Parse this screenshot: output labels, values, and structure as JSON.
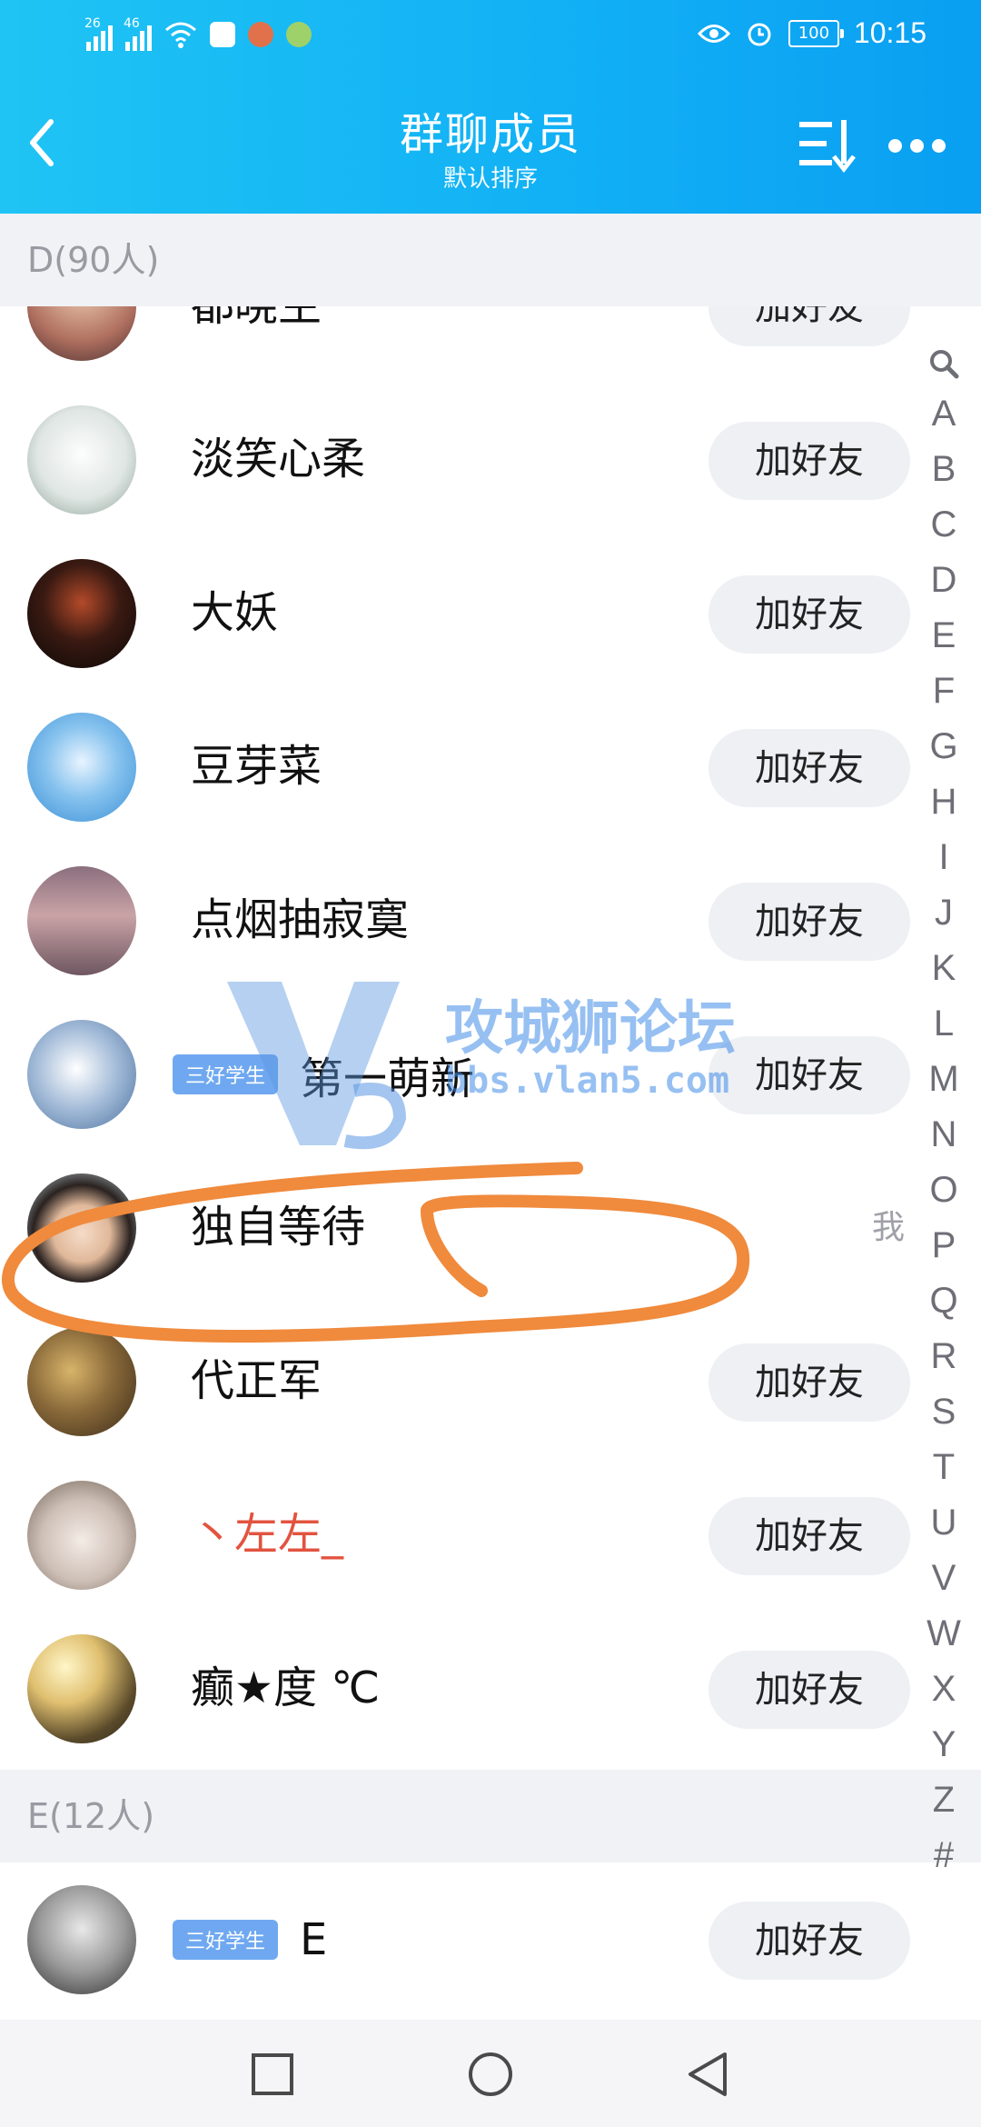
{
  "status_bar": {
    "left_indicators": [
      "26",
      "46"
    ],
    "time": "10:15",
    "battery": "100"
  },
  "header": {
    "title": "群聊成员",
    "subtitle": "默认排序"
  },
  "sections": [
    {
      "label": "D(90人)"
    },
    {
      "label": "E(12人)"
    }
  ],
  "members": [
    {
      "name": "都晓生",
      "action": "加好友"
    },
    {
      "name": "淡笑心柔",
      "action": "加好友"
    },
    {
      "name": "大妖",
      "action": "加好友"
    },
    {
      "name": "豆芽菜",
      "action": "加好友"
    },
    {
      "name": "点烟抽寂寞",
      "action": "加好友"
    },
    {
      "name": "第一萌新",
      "badge": "三好学生",
      "action": "加好友"
    },
    {
      "name": "独自等待",
      "self_label": "我"
    },
    {
      "name": "代正军",
      "action": "加好友"
    },
    {
      "name": "丶左左_",
      "action": "加好友"
    },
    {
      "name": "癫★度 ℃",
      "action": "加好友"
    },
    {
      "name": "E",
      "badge": "三好学生",
      "action": "加好友"
    }
  ],
  "index_bar": [
    "A",
    "B",
    "C",
    "D",
    "E",
    "F",
    "G",
    "H",
    "I",
    "J",
    "K",
    "L",
    "M",
    "N",
    "O",
    "P",
    "Q",
    "R",
    "S",
    "T",
    "U",
    "V",
    "W",
    "X",
    "Y",
    "Z",
    "#"
  ],
  "watermark": {
    "title": "攻城狮论坛",
    "url": "bbs.vlan5.com"
  },
  "colors": {
    "header": "#12b1f5",
    "section_bg": "#f1f2f6",
    "button_bg": "#eef0f4",
    "badge": "#6fa8f0",
    "annotation": "#f08a3c",
    "red_name": "#e2533f"
  }
}
